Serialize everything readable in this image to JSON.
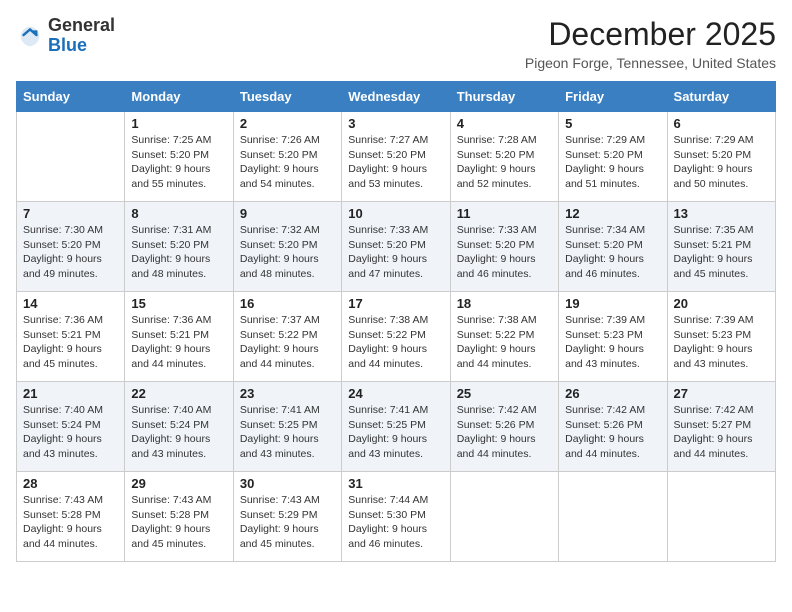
{
  "logo": {
    "general": "General",
    "blue": "Blue"
  },
  "header": {
    "month_year": "December 2025",
    "location": "Pigeon Forge, Tennessee, United States"
  },
  "days_of_week": [
    "Sunday",
    "Monday",
    "Tuesday",
    "Wednesday",
    "Thursday",
    "Friday",
    "Saturday"
  ],
  "weeks": [
    [
      {
        "day": "",
        "sunrise": "",
        "sunset": "",
        "daylight": ""
      },
      {
        "day": "1",
        "sunrise": "Sunrise: 7:25 AM",
        "sunset": "Sunset: 5:20 PM",
        "daylight": "Daylight: 9 hours and 55 minutes."
      },
      {
        "day": "2",
        "sunrise": "Sunrise: 7:26 AM",
        "sunset": "Sunset: 5:20 PM",
        "daylight": "Daylight: 9 hours and 54 minutes."
      },
      {
        "day": "3",
        "sunrise": "Sunrise: 7:27 AM",
        "sunset": "Sunset: 5:20 PM",
        "daylight": "Daylight: 9 hours and 53 minutes."
      },
      {
        "day": "4",
        "sunrise": "Sunrise: 7:28 AM",
        "sunset": "Sunset: 5:20 PM",
        "daylight": "Daylight: 9 hours and 52 minutes."
      },
      {
        "day": "5",
        "sunrise": "Sunrise: 7:29 AM",
        "sunset": "Sunset: 5:20 PM",
        "daylight": "Daylight: 9 hours and 51 minutes."
      },
      {
        "day": "6",
        "sunrise": "Sunrise: 7:29 AM",
        "sunset": "Sunset: 5:20 PM",
        "daylight": "Daylight: 9 hours and 50 minutes."
      }
    ],
    [
      {
        "day": "7",
        "sunrise": "Sunrise: 7:30 AM",
        "sunset": "Sunset: 5:20 PM",
        "daylight": "Daylight: 9 hours and 49 minutes."
      },
      {
        "day": "8",
        "sunrise": "Sunrise: 7:31 AM",
        "sunset": "Sunset: 5:20 PM",
        "daylight": "Daylight: 9 hours and 48 minutes."
      },
      {
        "day": "9",
        "sunrise": "Sunrise: 7:32 AM",
        "sunset": "Sunset: 5:20 PM",
        "daylight": "Daylight: 9 hours and 48 minutes."
      },
      {
        "day": "10",
        "sunrise": "Sunrise: 7:33 AM",
        "sunset": "Sunset: 5:20 PM",
        "daylight": "Daylight: 9 hours and 47 minutes."
      },
      {
        "day": "11",
        "sunrise": "Sunrise: 7:33 AM",
        "sunset": "Sunset: 5:20 PM",
        "daylight": "Daylight: 9 hours and 46 minutes."
      },
      {
        "day": "12",
        "sunrise": "Sunrise: 7:34 AM",
        "sunset": "Sunset: 5:20 PM",
        "daylight": "Daylight: 9 hours and 46 minutes."
      },
      {
        "day": "13",
        "sunrise": "Sunrise: 7:35 AM",
        "sunset": "Sunset: 5:21 PM",
        "daylight": "Daylight: 9 hours and 45 minutes."
      }
    ],
    [
      {
        "day": "14",
        "sunrise": "Sunrise: 7:36 AM",
        "sunset": "Sunset: 5:21 PM",
        "daylight": "Daylight: 9 hours and 45 minutes."
      },
      {
        "day": "15",
        "sunrise": "Sunrise: 7:36 AM",
        "sunset": "Sunset: 5:21 PM",
        "daylight": "Daylight: 9 hours and 44 minutes."
      },
      {
        "day": "16",
        "sunrise": "Sunrise: 7:37 AM",
        "sunset": "Sunset: 5:22 PM",
        "daylight": "Daylight: 9 hours and 44 minutes."
      },
      {
        "day": "17",
        "sunrise": "Sunrise: 7:38 AM",
        "sunset": "Sunset: 5:22 PM",
        "daylight": "Daylight: 9 hours and 44 minutes."
      },
      {
        "day": "18",
        "sunrise": "Sunrise: 7:38 AM",
        "sunset": "Sunset: 5:22 PM",
        "daylight": "Daylight: 9 hours and 44 minutes."
      },
      {
        "day": "19",
        "sunrise": "Sunrise: 7:39 AM",
        "sunset": "Sunset: 5:23 PM",
        "daylight": "Daylight: 9 hours and 43 minutes."
      },
      {
        "day": "20",
        "sunrise": "Sunrise: 7:39 AM",
        "sunset": "Sunset: 5:23 PM",
        "daylight": "Daylight: 9 hours and 43 minutes."
      }
    ],
    [
      {
        "day": "21",
        "sunrise": "Sunrise: 7:40 AM",
        "sunset": "Sunset: 5:24 PM",
        "daylight": "Daylight: 9 hours and 43 minutes."
      },
      {
        "day": "22",
        "sunrise": "Sunrise: 7:40 AM",
        "sunset": "Sunset: 5:24 PM",
        "daylight": "Daylight: 9 hours and 43 minutes."
      },
      {
        "day": "23",
        "sunrise": "Sunrise: 7:41 AM",
        "sunset": "Sunset: 5:25 PM",
        "daylight": "Daylight: 9 hours and 43 minutes."
      },
      {
        "day": "24",
        "sunrise": "Sunrise: 7:41 AM",
        "sunset": "Sunset: 5:25 PM",
        "daylight": "Daylight: 9 hours and 43 minutes."
      },
      {
        "day": "25",
        "sunrise": "Sunrise: 7:42 AM",
        "sunset": "Sunset: 5:26 PM",
        "daylight": "Daylight: 9 hours and 44 minutes."
      },
      {
        "day": "26",
        "sunrise": "Sunrise: 7:42 AM",
        "sunset": "Sunset: 5:26 PM",
        "daylight": "Daylight: 9 hours and 44 minutes."
      },
      {
        "day": "27",
        "sunrise": "Sunrise: 7:42 AM",
        "sunset": "Sunset: 5:27 PM",
        "daylight": "Daylight: 9 hours and 44 minutes."
      }
    ],
    [
      {
        "day": "28",
        "sunrise": "Sunrise: 7:43 AM",
        "sunset": "Sunset: 5:28 PM",
        "daylight": "Daylight: 9 hours and 44 minutes."
      },
      {
        "day": "29",
        "sunrise": "Sunrise: 7:43 AM",
        "sunset": "Sunset: 5:28 PM",
        "daylight": "Daylight: 9 hours and 45 minutes."
      },
      {
        "day": "30",
        "sunrise": "Sunrise: 7:43 AM",
        "sunset": "Sunset: 5:29 PM",
        "daylight": "Daylight: 9 hours and 45 minutes."
      },
      {
        "day": "31",
        "sunrise": "Sunrise: 7:44 AM",
        "sunset": "Sunset: 5:30 PM",
        "daylight": "Daylight: 9 hours and 46 minutes."
      },
      {
        "day": "",
        "sunrise": "",
        "sunset": "",
        "daylight": ""
      },
      {
        "day": "",
        "sunrise": "",
        "sunset": "",
        "daylight": ""
      },
      {
        "day": "",
        "sunrise": "",
        "sunset": "",
        "daylight": ""
      }
    ]
  ]
}
